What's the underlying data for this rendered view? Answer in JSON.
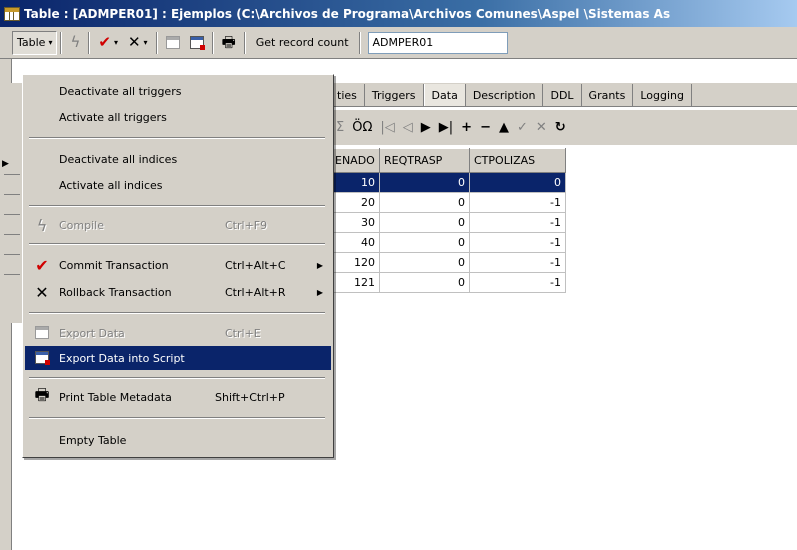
{
  "window": {
    "title": "Table : [ADMPER01] : Ejemplos (C:\\Archivos de Programa\\Archivos Comunes\\Aspel \\Sistemas As"
  },
  "toolbar": {
    "table_button": "Table",
    "table_arrow": "▾",
    "compile_icon": "ϟ",
    "commit_icon": "✔",
    "rollback_icon": "✕",
    "dropdown_arrow": "▾",
    "print_icon": "🖶",
    "record_count_button": "Get record count",
    "table_name_field": "ADMPER01"
  },
  "tabs": [
    "ties",
    "Triggers",
    "Data",
    "Description",
    "DDL",
    "Grants",
    "Logging"
  ],
  "active_tab": "Data",
  "navigator": {
    "filter_left": "Σ",
    "filter_label": "ÖΩ",
    "first": "|◁",
    "prior": "◁",
    "next": "▶",
    "last": "▶|",
    "insert": "+",
    "delete": "−",
    "edit": "▲",
    "post": "✓",
    "cancel": "✕",
    "refresh": "↻"
  },
  "grid": {
    "columns": [
      "ENADO",
      "REQTRASP",
      "CTPOLIZAS"
    ],
    "rows": [
      [
        "10",
        "0",
        "0"
      ],
      [
        "20",
        "0",
        "-1"
      ],
      [
        "30",
        "0",
        "-1"
      ],
      [
        "40",
        "0",
        "-1"
      ],
      [
        "120",
        "0",
        "-1"
      ],
      [
        "121",
        "0",
        "-1"
      ]
    ],
    "selected_row": 0,
    "row_indicator": "▶"
  },
  "menu": {
    "deactivate_triggers": "Deactivate all triggers",
    "activate_triggers": "Activate all triggers",
    "deactivate_indices": "Deactivate all indices",
    "activate_indices": "Activate all indices",
    "compile": "Compile",
    "compile_shortcut": "Ctrl+F9",
    "commit": "Commit Transaction",
    "commit_shortcut": "Ctrl+Alt+C",
    "rollback": "Rollback Transaction",
    "rollback_shortcut": "Ctrl+Alt+R",
    "export_data": "Export Data",
    "export_data_shortcut": "Ctrl+E",
    "export_script": "Export Data into Script",
    "print_metadata": "Print Table Metadata",
    "print_metadata_shortcut": "Shift+Ctrl+P",
    "empty_table": "Empty Table",
    "submenu_arrow": "▶",
    "compile_icon": "ϟ",
    "commit_icon": "✔",
    "rollback_icon": "✕",
    "print_icon": "🖶"
  }
}
